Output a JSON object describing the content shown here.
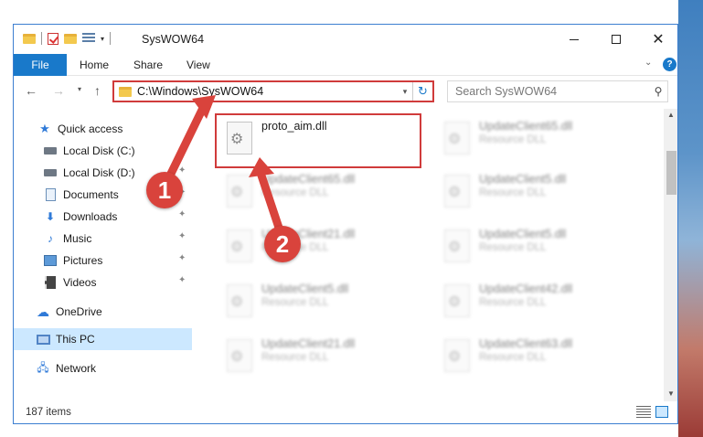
{
  "window": {
    "title": "SysWOW64"
  },
  "ribbon": {
    "tabs": [
      "File",
      "Home",
      "Share",
      "View"
    ],
    "help_label": "?"
  },
  "nav": {
    "address": "C:\\Windows\\SysWOW64",
    "search_placeholder": "Search SysWOW64"
  },
  "navpane": {
    "items": [
      {
        "label": "Quick access",
        "icon": "star-icon"
      },
      {
        "label": "Local Disk (C:)",
        "icon": "disk-icon",
        "pinned": true
      },
      {
        "label": "Local Disk (D:)",
        "icon": "disk-icon",
        "pinned": true
      },
      {
        "label": "Documents",
        "icon": "documents-icon",
        "pinned": true
      },
      {
        "label": "Downloads",
        "icon": "downloads-icon",
        "pinned": true
      },
      {
        "label": "Music",
        "icon": "music-icon",
        "pinned": true
      },
      {
        "label": "Pictures",
        "icon": "pictures-icon",
        "pinned": true
      },
      {
        "label": "Videos",
        "icon": "videos-icon",
        "pinned": true
      },
      {
        "label": "OneDrive",
        "icon": "onedrive-icon"
      },
      {
        "label": "This PC",
        "icon": "this-pc-icon",
        "selected": true
      },
      {
        "label": "Network",
        "icon": "network-icon"
      }
    ]
  },
  "files": {
    "highlighted": {
      "name": "proto_aim.dll"
    },
    "others": [
      {
        "name": "UpdateClient65.dll",
        "type": "Resource DLL"
      },
      {
        "name": "UpdateClient65.dll",
        "type": "Resource DLL"
      },
      {
        "name": "UpdateClient5.dll",
        "type": "Resource DLL"
      },
      {
        "name": "UpdateClient21.dll",
        "type": "Resource DLL"
      },
      {
        "name": "UpdateClient5.dll",
        "type": "Resource DLL"
      },
      {
        "name": "UpdateClient5.dll",
        "type": "Resource DLL"
      },
      {
        "name": "UpdateClient42.dll",
        "type": "Resource DLL"
      },
      {
        "name": "UpdateClient21.dll",
        "type": "Resource DLL"
      },
      {
        "name": "UpdateClient63.dll",
        "type": "Resource DLL"
      }
    ]
  },
  "status": {
    "item_count": "187 items"
  },
  "annotations": {
    "marker_1": "1",
    "marker_2": "2",
    "color": "#d9433c"
  }
}
